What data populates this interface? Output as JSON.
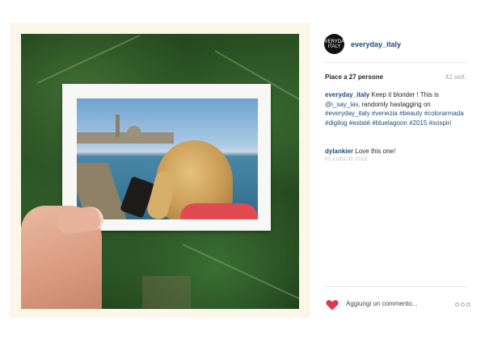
{
  "post": {
    "username": "everyday_italy",
    "avatar_text": "EVERYDAY ITALY",
    "likes": "Piace a 27 persone",
    "time_ago": "42 sett."
  },
  "caption": {
    "user": "everyday_italy",
    "text1": "Keep it blonder ! This is ",
    "mention": "@i_say_lav",
    "text2": ", randomly hastagging on ",
    "hashtags": "#everyday_italy #venezia #beauty #colorarmada #digilog #estaté #bluelagoon #2015 #sospiri"
  },
  "comments": [
    {
      "user": "dylankier",
      "text": "Love this one!"
    }
  ],
  "post_date": "01 LUGLIO 2015",
  "footer": {
    "add_comment_placeholder": "Aggiungi un commento..."
  },
  "colors": {
    "link": "#1e4d7a",
    "like_heart": "#e0364c",
    "frame": "#fbf6e8"
  },
  "icons": {
    "like": "heart-icon",
    "more": "more-options-icon"
  }
}
